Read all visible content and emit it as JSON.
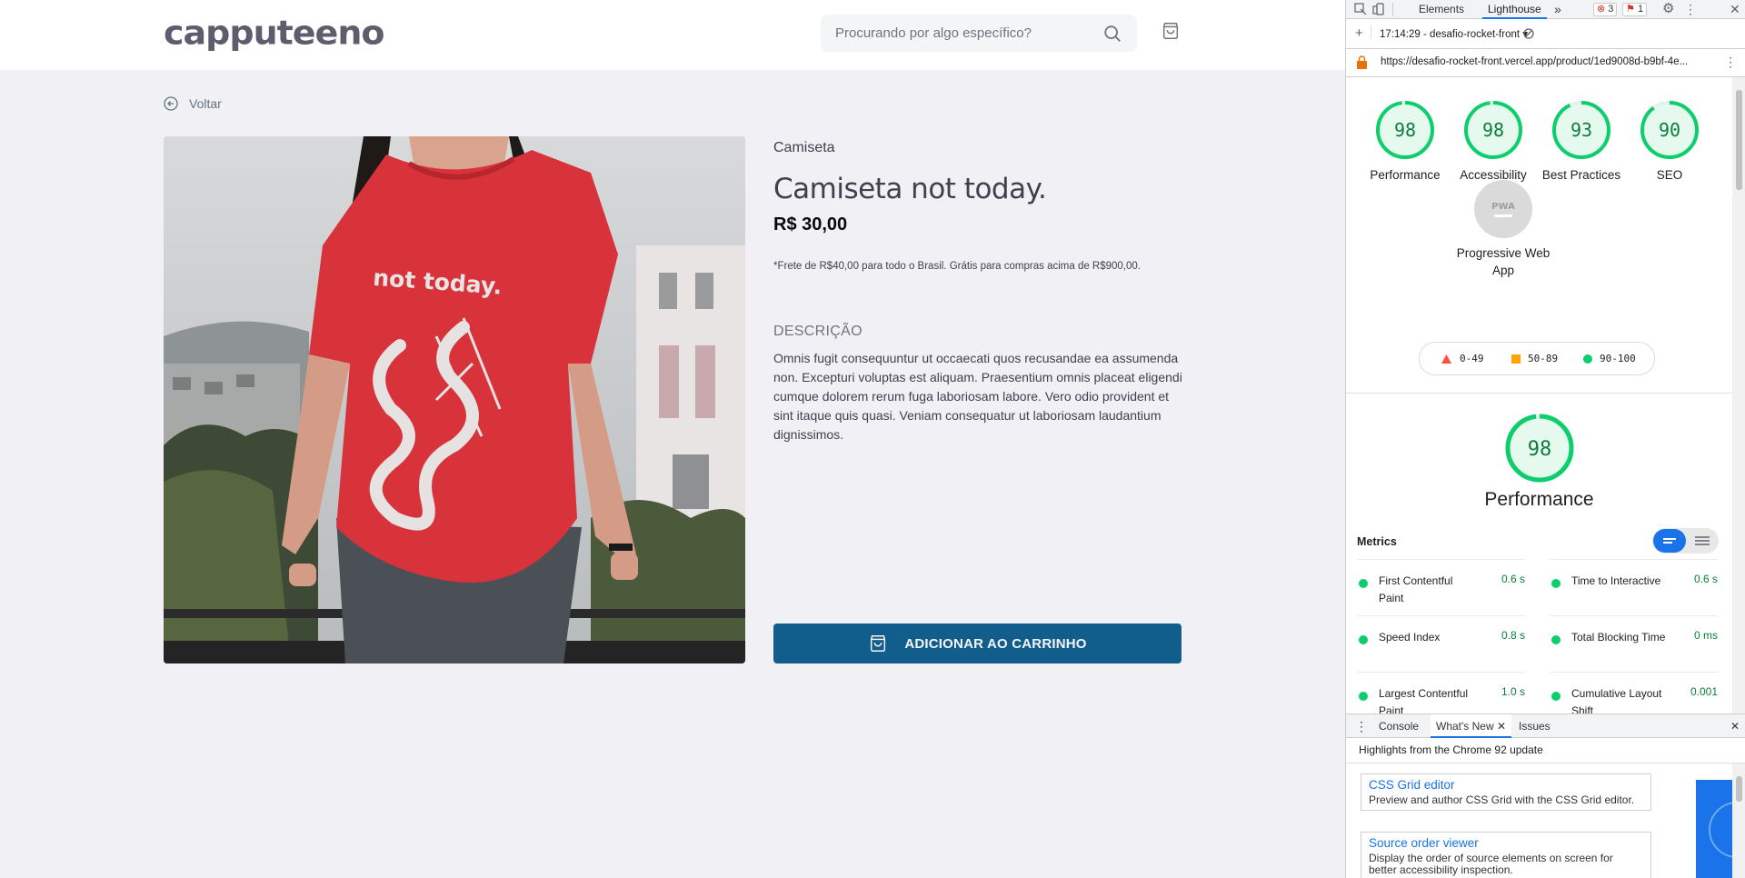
{
  "store": {
    "logo": "capputeeno",
    "search_placeholder": "Procurando por algo específico?",
    "back_label": "Voltar",
    "product": {
      "category": "Camiseta",
      "name": "Camiseta not today.",
      "price": "R$ 30,00",
      "shipping_note": "*Frete de R$40,00 para todo o Brasil. Grátis para compras acima de R$900,00.",
      "description_label": "Descrição",
      "description": "Omnis fugit consequuntur ut occaecati quos recusandae ea assumenda non. Excepturi voluptas est aliquam. Praesentium omnis placeat eligendi cumque dolorem rerum fuga laboriosam labore. Vero odio provident et sint itaque quis quasi. Veniam consequatur ut laboriosam laudantium dignissimos.",
      "shirt_print": "not today."
    },
    "add_to_cart_label": "ADICIONAR AO CARRINHO",
    "colors": {
      "button": "#115d8c",
      "shirt": "#d8333b"
    }
  },
  "devtools": {
    "tabs": [
      "Elements",
      "Lighthouse"
    ],
    "active_tab": "Lighthouse",
    "more": "»",
    "errors_count": "3",
    "issues_count": "1",
    "report_selector": "17:14:29 - desafio-rocket-front",
    "url": "https://desafio-rocket-front.vercel.app/product/1ed9008d-b9bf-4e...",
    "scores": [
      {
        "label": "Performance",
        "value": 98
      },
      {
        "label": "Accessibility",
        "value": 98
      },
      {
        "label": "Best Practices",
        "value": 93
      },
      {
        "label": "SEO",
        "value": 90
      }
    ],
    "pwa": {
      "badge": "PWA",
      "label": "Progressive Web App"
    },
    "legend": [
      {
        "range": "0-49",
        "color": "#ff4e42"
      },
      {
        "range": "50-89",
        "color": "#ffa400"
      },
      {
        "range": "90-100",
        "color": "#0cce6b"
      }
    ],
    "performance": {
      "score": 98,
      "label": "Performance"
    },
    "metrics_title": "Metrics",
    "metrics": [
      {
        "name": "First Contentful Paint",
        "value": "0.6 s"
      },
      {
        "name": "Time to Interactive",
        "value": "0.6 s"
      },
      {
        "name": "Speed Index",
        "value": "0.8 s"
      },
      {
        "name": "Total Blocking Time",
        "value": "0 ms"
      },
      {
        "name": "Largest Contentful Paint",
        "value": "1.0 s"
      },
      {
        "name": "Cumulative Layout Shift",
        "value": "0.001"
      }
    ],
    "drawer": {
      "tabs": [
        "Console",
        "What's New",
        "Issues"
      ],
      "active_tab": "What's New",
      "heading": "Highlights from the Chrome 92 update",
      "cards": [
        {
          "title": "CSS Grid editor",
          "desc": "Preview and author CSS Grid with the CSS Grid editor."
        },
        {
          "title": "Source order viewer",
          "desc": "Display the order of source elements on screen for better accessibility inspection."
        }
      ]
    }
  }
}
